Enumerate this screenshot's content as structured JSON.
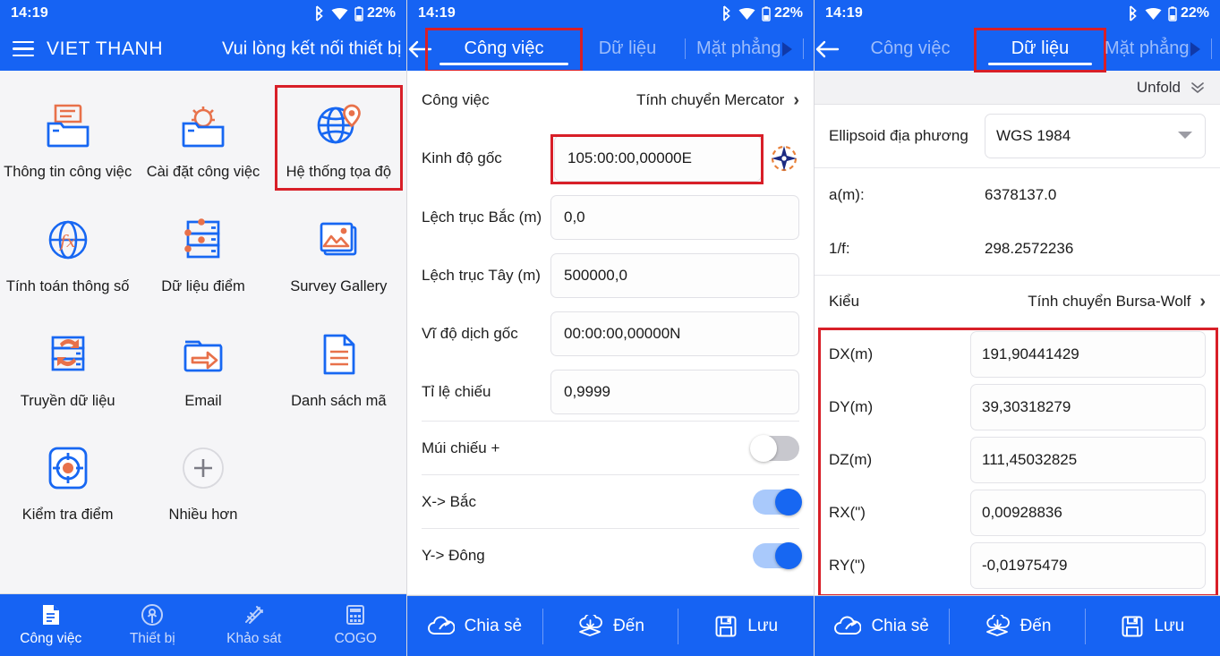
{
  "status_bar": {
    "time": "14:19",
    "battery": "22%"
  },
  "colors": {
    "brand_blue": "#1663f3",
    "highlight_red": "#d81f28",
    "accent_orange": "#e8714a"
  },
  "panel1": {
    "appbar": {
      "brand": "VIET THANH",
      "connect_message": "Vui lòng kết nối thiết bị"
    },
    "grid": [
      {
        "label": "Thông tin công việc",
        "icon": "folder-document-icon",
        "highlight": false
      },
      {
        "label": "Cài đặt công việc",
        "icon": "folder-gear-icon",
        "highlight": false
      },
      {
        "label": "Hệ thống tọa độ",
        "icon": "globe-pin-icon",
        "highlight": true
      },
      {
        "label": "Tính toán thông số",
        "icon": "globe-fx-icon",
        "highlight": false
      },
      {
        "label": "Dữ liệu điểm",
        "icon": "point-data-icon",
        "highlight": false
      },
      {
        "label": "Survey Gallery",
        "icon": "gallery-image-icon",
        "highlight": false
      },
      {
        "label": "Truyền dữ liệu",
        "icon": "data-transfer-icon",
        "highlight": false
      },
      {
        "label": "Email",
        "icon": "folder-arrow-icon",
        "highlight": false
      },
      {
        "label": "Danh sách mã",
        "icon": "code-list-icon",
        "highlight": false
      },
      {
        "label": "Kiểm tra điểm",
        "icon": "point-check-icon",
        "highlight": false
      },
      {
        "label": "Nhiều hơn",
        "icon": "plus-circle-icon",
        "highlight": false
      }
    ],
    "bottom_nav": [
      {
        "label": "Công việc",
        "icon": "job-document-icon",
        "active": true
      },
      {
        "label": "Thiết bị",
        "icon": "antenna-icon",
        "active": false
      },
      {
        "label": "Khảo sát",
        "icon": "survey-icon",
        "active": false
      },
      {
        "label": "COGO",
        "icon": "calculator-icon",
        "active": false
      }
    ]
  },
  "panel2": {
    "tabs": [
      {
        "label": "Công việc",
        "active": true,
        "highlighted": true
      },
      {
        "label": "Dữ liệu",
        "active": false,
        "highlighted": false
      },
      {
        "label": "Mặt phẳng",
        "active": false,
        "highlighted": false
      }
    ],
    "help_label": "?",
    "rows": [
      {
        "label": "Công việc",
        "value": "Tính chuyển Mercator",
        "kind": "chevron"
      },
      {
        "label": "Kinh độ gốc",
        "value": "105:00:00,00000E",
        "kind": "field-compass",
        "highlighted": true
      },
      {
        "label": "Lệch trục Bắc (m)",
        "value": "0,0",
        "kind": "field"
      },
      {
        "label": "Lệch trục Tây (m)",
        "value": "500000,0",
        "kind": "field"
      },
      {
        "label": "Vĩ độ dịch gốc",
        "value": "00:00:00,00000N",
        "kind": "field"
      },
      {
        "label": "Tỉ lệ chiếu",
        "value": "0,9999",
        "kind": "field"
      }
    ],
    "toggles": [
      {
        "label": "Múi chiếu +",
        "on": false
      },
      {
        "label": "X-> Bắc",
        "on": true
      },
      {
        "label": "Y-> Đông",
        "on": true
      }
    ],
    "actions": [
      {
        "label": "Chia sẻ",
        "icon": "cloud-share-icon"
      },
      {
        "label": "Đến",
        "icon": "cloud-download-icon"
      },
      {
        "label": "Lưu",
        "icon": "floppy-save-icon"
      }
    ]
  },
  "panel3": {
    "tabs": [
      {
        "label": "Công việc",
        "active": false,
        "highlighted": false
      },
      {
        "label": "Dữ liệu",
        "active": true,
        "highlighted": true
      },
      {
        "label": "Mặt phẳng",
        "active": false,
        "highlighted": false
      }
    ],
    "help_label": "?",
    "unfold_label": "Unfold",
    "ellipsoid": {
      "label": "Ellipsoid địa phương",
      "value": "WGS 1984"
    },
    "params": [
      {
        "label": "a(m):",
        "value": "6378137.0"
      },
      {
        "label": "1/f:",
        "value": "298.2572236"
      }
    ],
    "method": {
      "label": "Kiểu",
      "value": "Tính chuyển Bursa-Wolf"
    },
    "transform_fields": [
      {
        "label": "DX(m)",
        "value": "191,90441429"
      },
      {
        "label": "DY(m)",
        "value": "39,30318279"
      },
      {
        "label": "DZ(m)",
        "value": "111,45032825"
      },
      {
        "label": "RX(\")",
        "value": "0,00928836"
      },
      {
        "label": "RY(\")",
        "value": "-0,01975479"
      }
    ],
    "actions": [
      {
        "label": "Chia sẻ",
        "icon": "cloud-share-icon"
      },
      {
        "label": "Đến",
        "icon": "cloud-download-icon"
      },
      {
        "label": "Lưu",
        "icon": "floppy-save-icon"
      }
    ]
  }
}
